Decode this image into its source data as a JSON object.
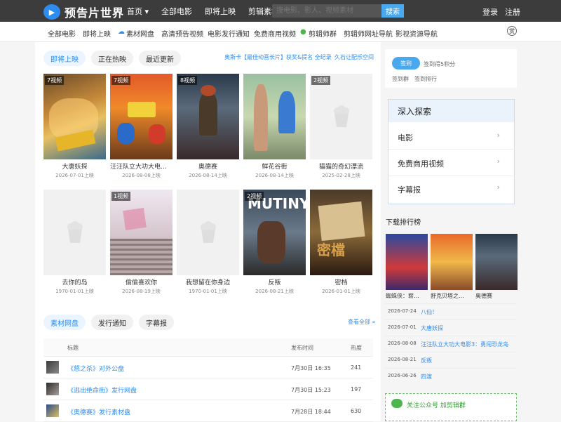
{
  "brand": {
    "name": "预告片世界",
    "accent": "#2d8cf0"
  },
  "topnav": {
    "items": [
      "首页 ▾",
      "全部电影",
      "即将上映",
      "剪辑素材"
    ],
    "search_placeholder": "搜电影、影人、视频素材",
    "search_button": "搜索",
    "login": "登录",
    "register": "注册"
  },
  "subnav": {
    "items": [
      "全部电影",
      "即将上映",
      "素材网盘",
      "高清预告视频",
      "电影发行通知",
      "免费商用视频",
      "剪辑师群",
      "剪辑师网址导航",
      "影视资源导航"
    ],
    "reward": "赏"
  },
  "main": {
    "tabs": [
      "即将上映",
      "正在热映",
      "最近更新"
    ],
    "promo_links": [
      "奥斯卡【最佳动画长片】获奖&提名 全纪录",
      "久石让配乐空间"
    ],
    "movies": [
      {
        "title": "大唐妖探",
        "date": "2026-07-01上映",
        "badge": "7视频"
      },
      {
        "title": "汪汪队立大功大电影…",
        "date": "2026-08-08上映",
        "badge": "7视频"
      },
      {
        "title": "奥德赛",
        "date": "2026-08-14上映",
        "badge": "8视频"
      },
      {
        "title": "鲜花谷街",
        "date": "2026-08-14上映",
        "badge": ""
      },
      {
        "title": "猫猫的奇幻漂流",
        "date": "2025-02-28上映",
        "badge": "2视频"
      },
      {
        "title": "去你的岛",
        "date": "1970-01-01上映",
        "badge": ""
      },
      {
        "title": "偷偷喜欢你",
        "date": "2026-08-19上映",
        "badge": "1视频"
      },
      {
        "title": "我想留在你身边",
        "date": "1970-01-01上映",
        "badge": ""
      },
      {
        "title": "反叛",
        "date": "2026-08-21上映",
        "badge": "2视频"
      },
      {
        "title": "密档",
        "date": "2026-01-01上映",
        "badge": ""
      }
    ],
    "poster_texts": {
      "p9": "MUTINY",
      "p10": "密檔"
    },
    "bottom_tabs": [
      "素材网盘",
      "发行通知",
      "字幕报"
    ],
    "view_all": "查看全部 »",
    "table_headers": [
      "标题",
      "发布时间",
      "热度"
    ],
    "rows": [
      {
        "title": "《怒之杀》对外公盘",
        "time": "7月30日 16:35",
        "hot": "241"
      },
      {
        "title": "《逃出绝命街》发行网盘",
        "time": "7月30日 15:23",
        "hot": "197"
      },
      {
        "title": "《奥德赛》发行素材盘",
        "time": "7月28日 18:44",
        "hot": "630"
      }
    ]
  },
  "sidebar": {
    "sign_button": "签到",
    "sign_reward": "签到得5积分",
    "sign_group": "签到群",
    "sign_rank": "签到排行",
    "explore_title": "深入探索",
    "explore_items": [
      "电影",
      "免费商用视频",
      "字幕报"
    ],
    "download_title": "下载排行榜",
    "downloads": [
      {
        "name": "蜘蛛侠：崭…"
      },
      {
        "name": "舒克贝塔之…"
      },
      {
        "name": "奥德赛"
      }
    ],
    "ranking": [
      {
        "date": "2026-07-24",
        "name": "八仙！"
      },
      {
        "date": "2026-07-01",
        "name": "大唐妖探"
      },
      {
        "date": "2026-08-08",
        "name": "汪汪队立大功大电影3：勇闯恐龙岛"
      },
      {
        "date": "2026-08-21",
        "name": "反叛"
      },
      {
        "date": "2026-06-26",
        "name": "四渡"
      }
    ],
    "wechat": "关注公众号 加剪辑群"
  }
}
